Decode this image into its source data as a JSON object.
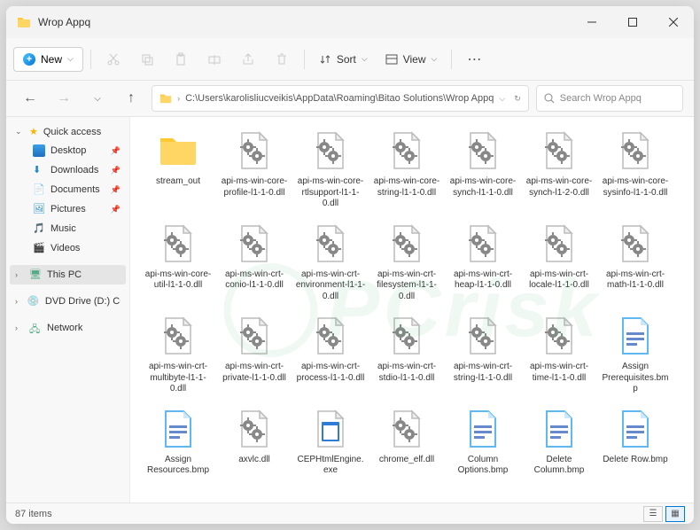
{
  "window": {
    "title": "Wrop Appq"
  },
  "toolbar": {
    "new_label": "New",
    "sort_label": "Sort",
    "view_label": "View"
  },
  "address": {
    "path": "C:\\Users\\karolisliucveikis\\AppData\\Roaming\\Bitao Solutions\\Wrop Appq",
    "search_placeholder": "Search Wrop Appq"
  },
  "sidebar": {
    "quick_access": "Quick access",
    "desktop": "Desktop",
    "downloads": "Downloads",
    "documents": "Documents",
    "pictures": "Pictures",
    "music": "Music",
    "videos": "Videos",
    "this_pc": "This PC",
    "dvd": "DVD Drive (D:) CCCC",
    "network": "Network"
  },
  "files": [
    {
      "name": "stream_out",
      "type": "folder"
    },
    {
      "name": "api-ms-win-core-profile-l1-1-0.dll",
      "type": "dll"
    },
    {
      "name": "api-ms-win-core-rtlsupport-l1-1-0.dll",
      "type": "dll"
    },
    {
      "name": "api-ms-win-core-string-l1-1-0.dll",
      "type": "dll"
    },
    {
      "name": "api-ms-win-core-synch-l1-1-0.dll",
      "type": "dll"
    },
    {
      "name": "api-ms-win-core-synch-l1-2-0.dll",
      "type": "dll"
    },
    {
      "name": "api-ms-win-core-sysinfo-l1-1-0.dll",
      "type": "dll"
    },
    {
      "name": "api-ms-win-core-util-l1-1-0.dll",
      "type": "dll"
    },
    {
      "name": "api-ms-win-crt-conio-l1-1-0.dll",
      "type": "dll"
    },
    {
      "name": "api-ms-win-crt-environment-l1-1-0.dll",
      "type": "dll"
    },
    {
      "name": "api-ms-win-crt-filesystem-l1-1-0.dll",
      "type": "dll"
    },
    {
      "name": "api-ms-win-crt-heap-l1-1-0.dll",
      "type": "dll"
    },
    {
      "name": "api-ms-win-crt-locale-l1-1-0.dll",
      "type": "dll"
    },
    {
      "name": "api-ms-win-crt-math-l1-1-0.dll",
      "type": "dll"
    },
    {
      "name": "api-ms-win-crt-multibyte-l1-1-0.dll",
      "type": "dll"
    },
    {
      "name": "api-ms-win-crt-private-l1-1-0.dll",
      "type": "dll"
    },
    {
      "name": "api-ms-win-crt-process-l1-1-0.dll",
      "type": "dll"
    },
    {
      "name": "api-ms-win-crt-stdio-l1-1-0.dll",
      "type": "dll"
    },
    {
      "name": "api-ms-win-crt-string-l1-1-0.dll",
      "type": "dll"
    },
    {
      "name": "api-ms-win-crt-time-l1-1-0.dll",
      "type": "dll"
    },
    {
      "name": "Assign Prerequisites.bmp",
      "type": "bmp"
    },
    {
      "name": "Assign Resources.bmp",
      "type": "bmp"
    },
    {
      "name": "axvlc.dll",
      "type": "dll"
    },
    {
      "name": "CEPHtmlEngine.exe",
      "type": "exe"
    },
    {
      "name": "chrome_elf.dll",
      "type": "dll"
    },
    {
      "name": "Column Options.bmp",
      "type": "bmp"
    },
    {
      "name": "Delete Column.bmp",
      "type": "bmp"
    },
    {
      "name": "Delete Row.bmp",
      "type": "bmp"
    }
  ],
  "status": {
    "count": "87 items"
  }
}
